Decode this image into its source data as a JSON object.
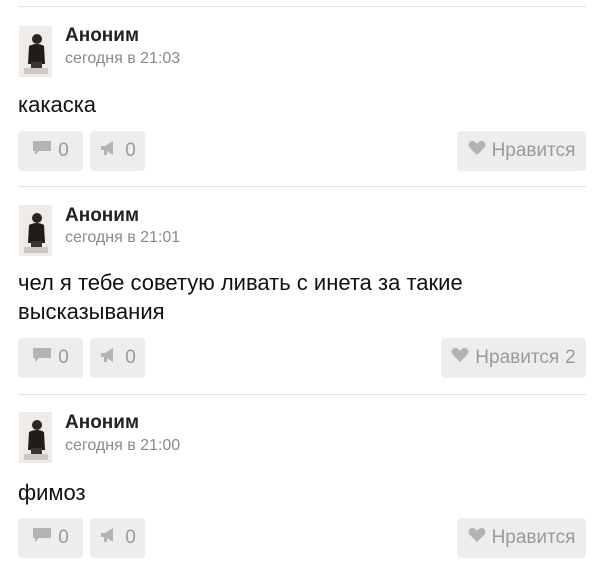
{
  "posts": [
    {
      "author": "Аноним",
      "time": "сегодня в 21:03",
      "text": "какаска",
      "comments": "0",
      "reposts": "0",
      "like_label": "Нравится",
      "like_count": ""
    },
    {
      "author": "Аноним",
      "time": "сегодня в 21:01",
      "text": "чел я тебе советую ливать с инета за такие высказывания",
      "comments": "0",
      "reposts": "0",
      "like_label": "Нравится",
      "like_count": "2"
    },
    {
      "author": "Аноним",
      "time": "сегодня в 21:00",
      "text": "фимоз",
      "comments": "0",
      "reposts": "0",
      "like_label": "Нравится",
      "like_count": ""
    }
  ],
  "icons": {
    "comment": "comment-icon",
    "repost": "megaphone-icon",
    "like": "heart-icon"
  },
  "colors": {
    "button_bg": "#ededed",
    "button_text": "#9a9a9a",
    "divider": "#e3e3e3",
    "time_text": "#8a8a8a"
  }
}
